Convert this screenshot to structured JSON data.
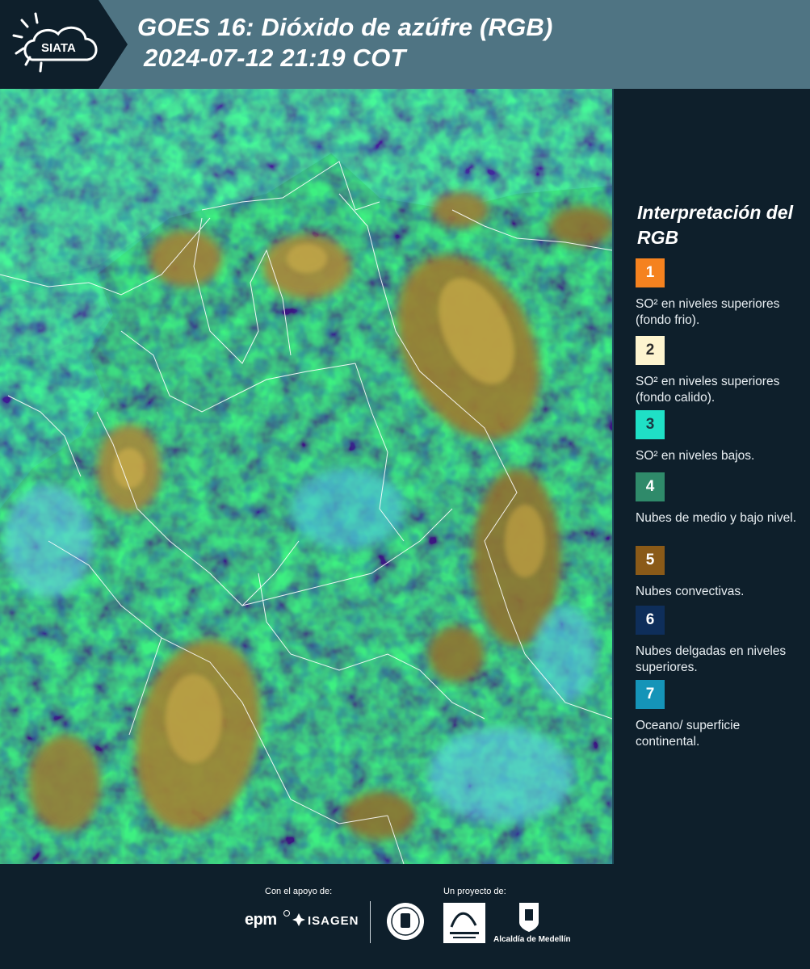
{
  "header": {
    "logo_text": "SIATA",
    "title_line1": "GOES 16: Dióxido de azúfre (RGB)",
    "title_line2": "2024-07-12 21:19 COT"
  },
  "legend": {
    "title": "Interpretación del RGB",
    "items": [
      {
        "num": "1",
        "color": "#f5821f",
        "num_color": "#ffffff",
        "text": "SO² en niveles superiores (fondo frio)."
      },
      {
        "num": "2",
        "color": "#fdf4cf",
        "num_color": "#2a2a2a",
        "text": "SO² en niveles superiores (fondo calido)."
      },
      {
        "num": "3",
        "color": "#1fe0c6",
        "num_color": "#1a3a44",
        "text": "SO² en niveles bajos."
      },
      {
        "num": "4",
        "color": "#2f8a6a",
        "num_color": "#ffffff",
        "text": "Nubes de medio y bajo nivel."
      },
      {
        "num": "5",
        "color": "#8a5a18",
        "num_color": "#ffffff",
        "text": "Nubes convectivas."
      },
      {
        "num": "6",
        "color": "#0e2e5a",
        "num_color": "#ffffff",
        "text": "Nubes delgadas en niveles superiores."
      },
      {
        "num": "7",
        "color": "#1594b8",
        "num_color": "#ffffff",
        "text": "Oceano/ superficie continental."
      }
    ]
  },
  "footer": {
    "support_label": "Con el apoyo de:",
    "project_label": "Un proyecto de:",
    "epm": "epm",
    "isagen": "ISAGEN",
    "alcaldia": "Alcaldía de Medellín"
  }
}
